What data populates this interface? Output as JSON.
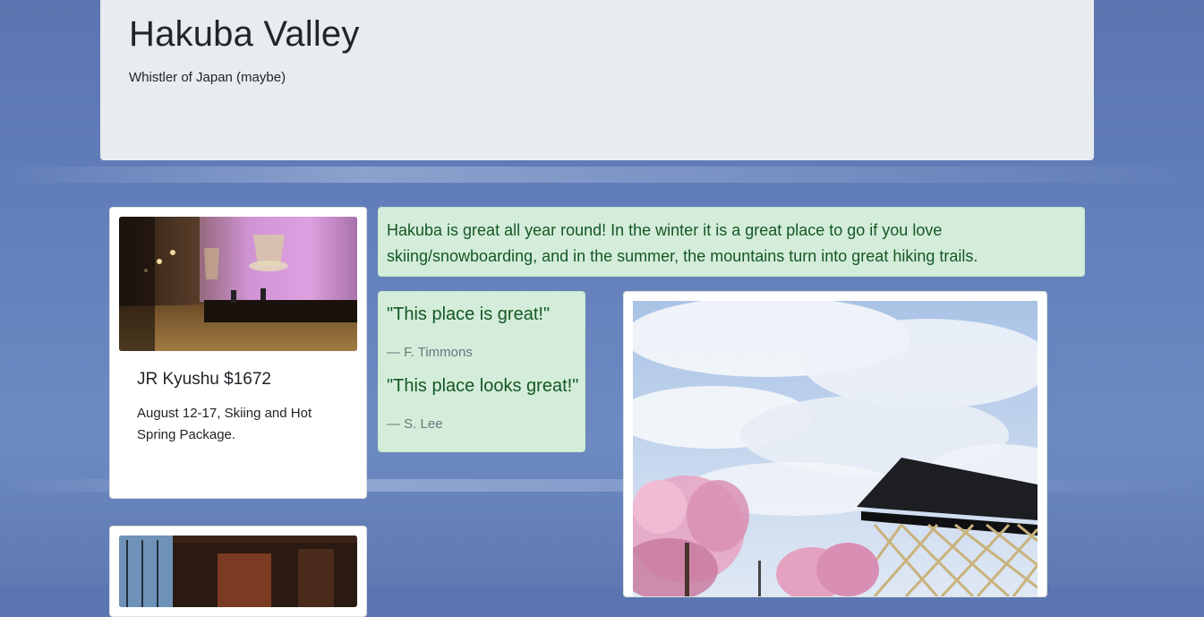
{
  "header": {
    "title": "Hakuba Valley",
    "subtitle": "Whistler of Japan (maybe)"
  },
  "deal_card": {
    "image_label": "hotel-lobby-photo",
    "title": "JR Kyushu $1672",
    "text": "August 12-17, Skiing and Hot Spring Package."
  },
  "description": {
    "text": "Hakuba is great all year round! In the winter it is a great place to go if you love skiing/snowboarding, and in the summer, the mountains turn into great hiking trails."
  },
  "testimonials": [
    {
      "quote": "\"This place is great!\"",
      "author": "— F. Timmons"
    },
    {
      "quote": "\"This place looks great!\"",
      "author": "— S. Lee"
    }
  ],
  "colors": {
    "background": "#6380bb",
    "jumbotron": "#e9ecef",
    "alert_bg": "#d4edda",
    "alert_text": "#155724",
    "muted": "#6c757d"
  }
}
